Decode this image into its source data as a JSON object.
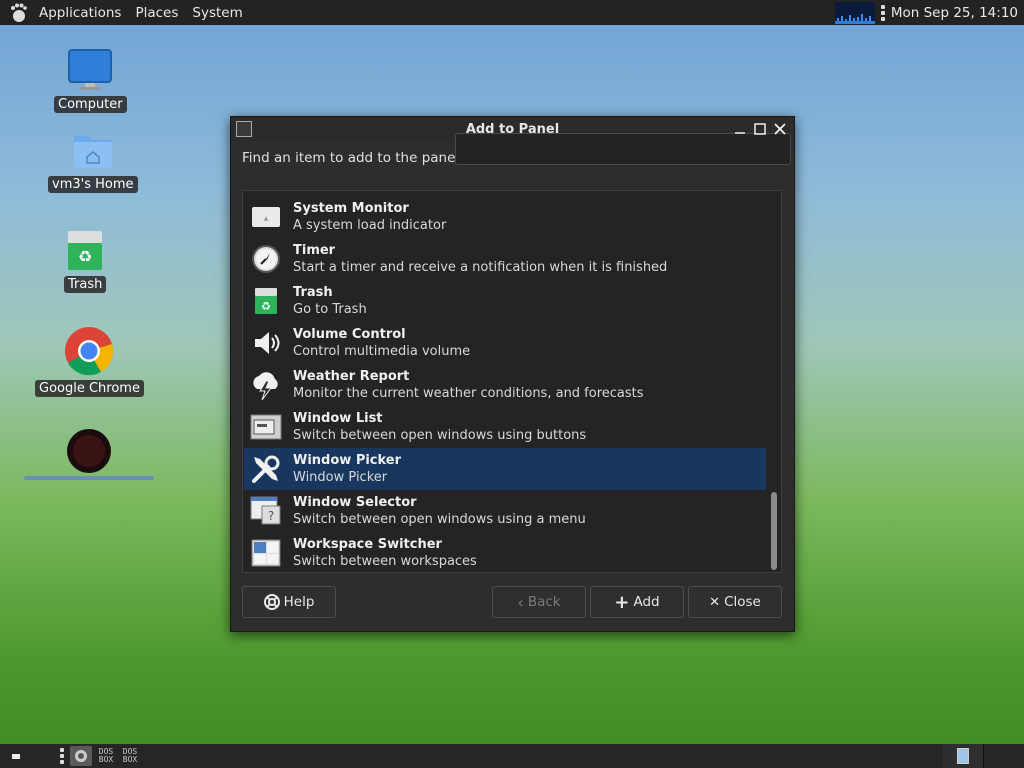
{
  "top_panel": {
    "menus": [
      "Applications",
      "Places",
      "System"
    ],
    "clock": "Mon Sep 25, 14:10"
  },
  "desktop": {
    "icons": [
      {
        "label": "Computer"
      },
      {
        "label": "vm3's Home"
      },
      {
        "label": "Trash"
      },
      {
        "label": "Google Chrome"
      },
      {
        "label": ""
      }
    ]
  },
  "dialog": {
    "title": "Add to Panel",
    "find_label": "Find an item to add to the panel:",
    "search_value": "",
    "items": [
      {
        "name": "System Monitor",
        "desc": "A system load indicator",
        "icon": "system-monitor-icon"
      },
      {
        "name": "Timer",
        "desc": "Start a timer and receive a notification when it is finished",
        "icon": "timer-icon"
      },
      {
        "name": "Trash",
        "desc": "Go to Trash",
        "icon": "trash-icon"
      },
      {
        "name": "Volume Control",
        "desc": "Control multimedia volume",
        "icon": "speaker-icon"
      },
      {
        "name": "Weather Report",
        "desc": "Monitor the current weather conditions, and forecasts",
        "icon": "weather-icon"
      },
      {
        "name": "Window List",
        "desc": "Switch between open windows using buttons",
        "icon": "window-list-icon"
      },
      {
        "name": "Window Picker",
        "desc": "Window Picker",
        "icon": "tools-icon",
        "selected": true
      },
      {
        "name": "Window Selector",
        "desc": "Switch between open windows using a menu",
        "icon": "window-selector-icon"
      },
      {
        "name": "Workspace Switcher",
        "desc": "Switch between workspaces",
        "icon": "workspace-switcher-icon"
      }
    ],
    "buttons": {
      "help": "Help",
      "back": "Back",
      "add": "Add",
      "close": "Close"
    }
  },
  "bottom_panel": {
    "dosbox_labels": [
      "DOS",
      "BOX"
    ]
  },
  "colors": {
    "selection": "#17375e",
    "panel": "#232323",
    "window_bg": "#2d2d2d"
  }
}
